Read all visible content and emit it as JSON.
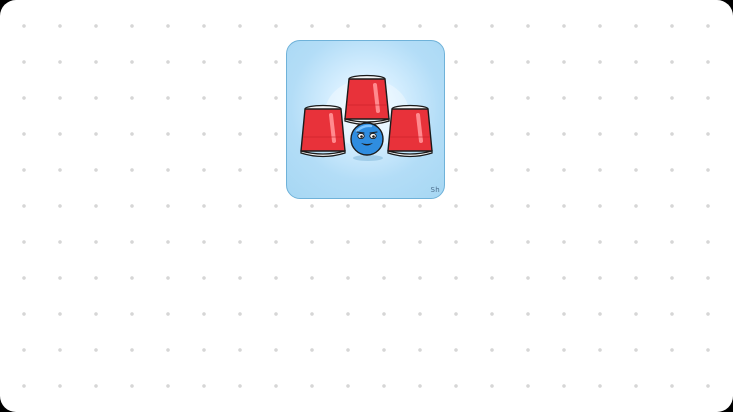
{
  "game": {
    "icon": {
      "name": "shell-game-cups-icon",
      "signature": "Sh",
      "colors": {
        "background": "#a6d7f3",
        "cup": "#e8323a",
        "cup_highlight": "#ff7a7e",
        "cup_rim": "#f5f5f5",
        "ball": "#2f8de0",
        "outline": "#1b1b1b"
      },
      "cups": 3
    }
  }
}
